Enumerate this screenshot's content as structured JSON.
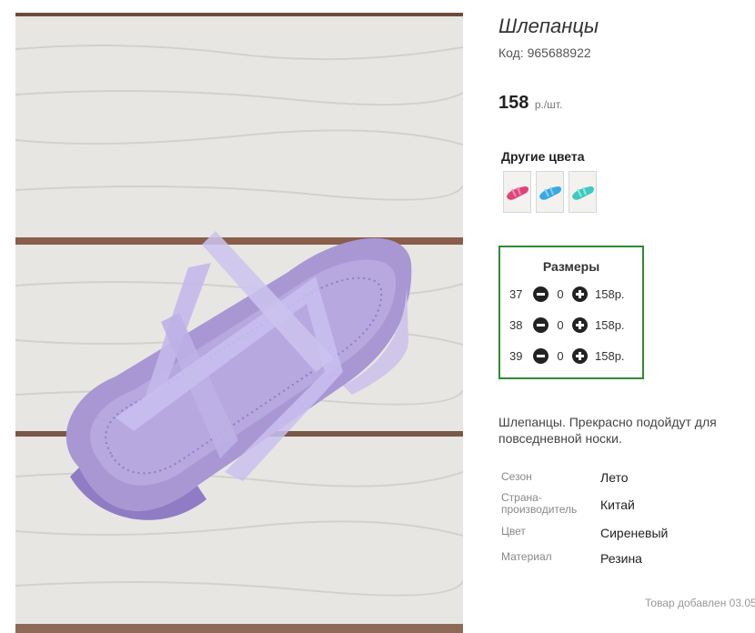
{
  "product": {
    "title": "Шлепанцы",
    "code": "Код: 965688922",
    "price_value": "158",
    "price_unit": "р./шт.",
    "photo_icon": "sandal-photo"
  },
  "colors": {
    "title": "Другие цвета",
    "swatches": [
      {
        "icon": "pink-sandal-thumbnail",
        "color": "#e0447a"
      },
      {
        "icon": "blue-sandal-thumbnail",
        "color": "#3aa9e4"
      },
      {
        "icon": "turquoise-sandal-thumbnail",
        "color": "#3fc9bf"
      }
    ]
  },
  "sizes": {
    "title": "Размеры",
    "border_color": "#2e8b2e",
    "rows": [
      {
        "size": "37",
        "qty": "0",
        "price": "158р."
      },
      {
        "size": "38",
        "qty": "0",
        "price": "158р."
      },
      {
        "size": "39",
        "qty": "0",
        "price": "158р."
      }
    ]
  },
  "description": "Шлепанцы. Прекрасно подойдут для повседневной носки.",
  "properties": [
    {
      "key": "Сезон",
      "value": "Лето"
    },
    {
      "key": "Страна-производитель",
      "value": "Китай"
    },
    {
      "key": "Цвет",
      "value": "Сиреневый"
    },
    {
      "key": "Материал",
      "value": "Резина"
    }
  ],
  "added": "Товар добавлен 03.05"
}
